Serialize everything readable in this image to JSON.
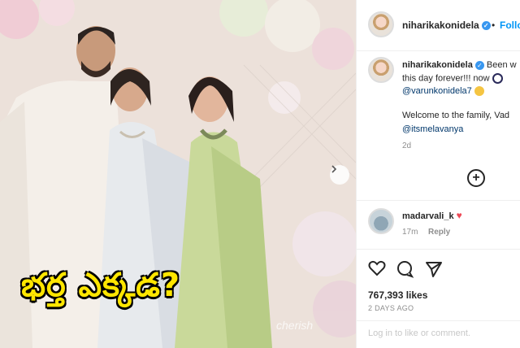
{
  "post": {
    "caption_overlay": "భర్త ఎక్కడ?",
    "watermark": "cherish"
  },
  "header": {
    "username": "niharikakonidela",
    "follow_label": "Follo",
    "separator": "•"
  },
  "comment_main": {
    "username": "niharikakonidela",
    "text_1": "Been w",
    "text_2": "this day forever!!! now",
    "mention_1": "@varunkonidela7",
    "text_3": "Welcome to the family, Vad",
    "mention_2": "@itsmelavanya",
    "time": "2d"
  },
  "comment_2": {
    "username": "madarvali_k",
    "time": "17m",
    "reply_label": "Reply"
  },
  "actions": {
    "likes": "767,393 likes",
    "date": "2 DAYS AGO",
    "login_prompt": "Log in to like or comment."
  }
}
